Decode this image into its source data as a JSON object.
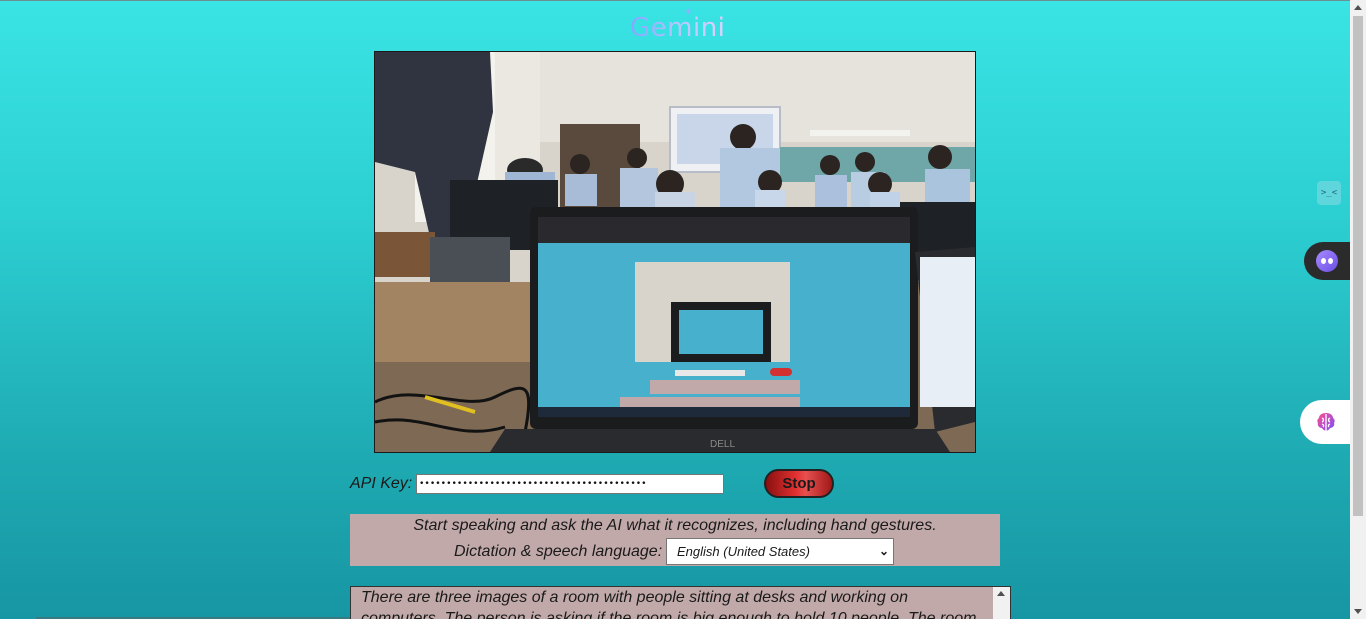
{
  "header": {
    "logo_text": "Gemini"
  },
  "camera": {
    "description_icon": "camera-feed-icon"
  },
  "api": {
    "label": "API Key:",
    "value": "••••••••••••••••••••••••••••••••••••••••••"
  },
  "controls": {
    "stop_label": "Stop"
  },
  "instructions": {
    "text": "Start speaking and ask the AI what it recognizes, including hand gestures.",
    "language_label": "Dictation & speech language:",
    "language_selected": "English (United States)"
  },
  "output": {
    "text": "There are three images of a room with people sitting at desks and working on computers. The person is asking if the room is big enough to hold 10 people. The room"
  },
  "extensions": {
    "terminal_icon": "terminal-icon",
    "bot_icon": "bot-assistant-icon",
    "brain_icon": "brain-icon"
  },
  "colors": {
    "background_top": "#3ae4e4",
    "background_bottom": "#1796a3",
    "panel": "#c2a9a9",
    "stop_button": "#e23030"
  }
}
